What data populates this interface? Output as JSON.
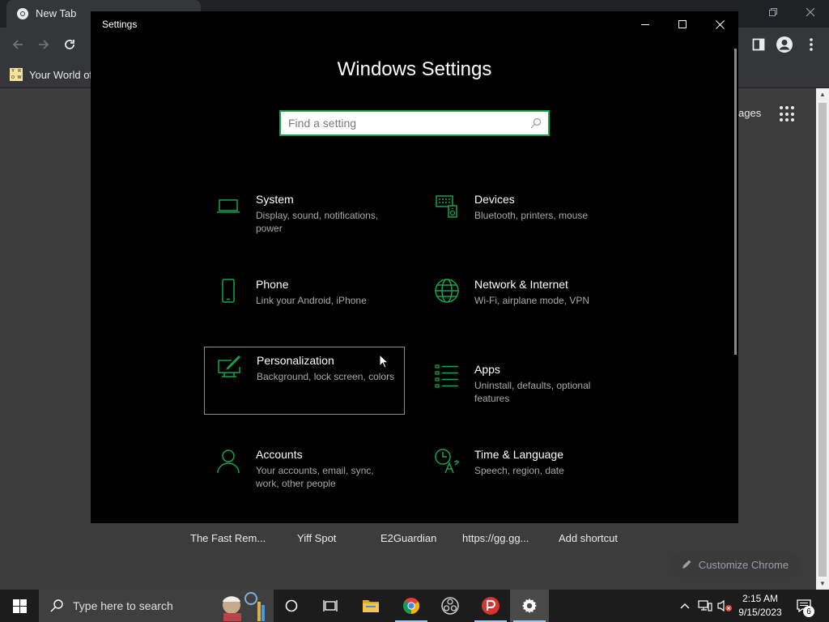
{
  "chrome": {
    "tab_title": "New Tab",
    "bookmark_label": "Your World of",
    "images_link": "ages",
    "shortcuts": [
      "The Fast Rem...",
      "Yiff Spot",
      "E2Guardian",
      "https://gg.gg...",
      "Add shortcut"
    ],
    "customize_label": "Customize Chrome"
  },
  "settings": {
    "window_title": "Settings",
    "heading": "Windows Settings",
    "search_placeholder": "Find a setting",
    "accent_color": "#16a34a",
    "categories": [
      {
        "title": "System",
        "desc": "Display, sound, notifications, power",
        "icon": "laptop-icon"
      },
      {
        "title": "Devices",
        "desc": "Bluetooth, printers, mouse",
        "icon": "keyboard-speaker-icon"
      },
      {
        "title": "Phone",
        "desc": "Link your Android, iPhone",
        "icon": "phone-icon"
      },
      {
        "title": "Network & Internet",
        "desc": "Wi-Fi, airplane mode, VPN",
        "icon": "globe-icon"
      },
      {
        "title": "Personalization",
        "desc": "Background, lock screen, colors",
        "icon": "paint-brush-icon"
      },
      {
        "title": "Apps",
        "desc": "Uninstall, defaults, optional features",
        "icon": "apps-list-icon"
      },
      {
        "title": "Accounts",
        "desc": "Your accounts, email, sync, work, other people",
        "icon": "person-icon"
      },
      {
        "title": "Time & Language",
        "desc": "Speech, region, date",
        "icon": "time-language-icon"
      }
    ]
  },
  "taskbar": {
    "search_placeholder": "Type here to search",
    "time": "2:15 AM",
    "date": "9/15/2023",
    "notification_count": "6"
  }
}
